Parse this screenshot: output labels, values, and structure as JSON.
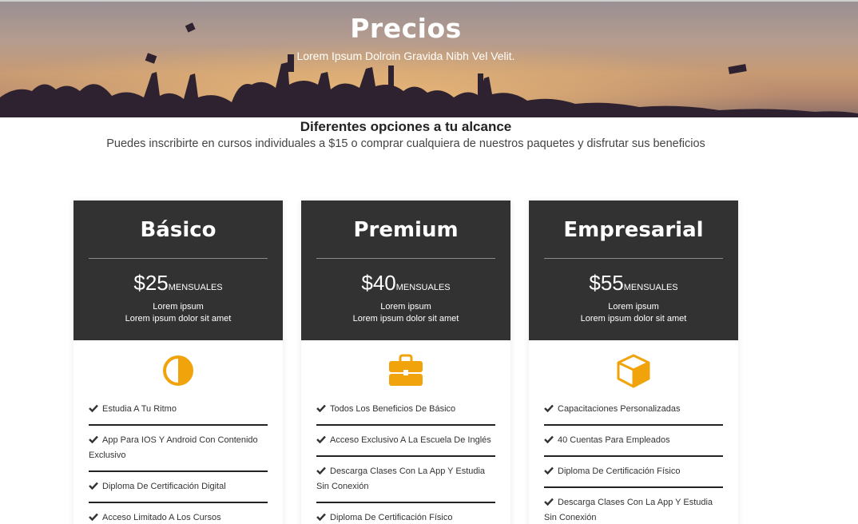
{
  "hero": {
    "title": "Precios",
    "subtitle": "Lorem Ipsum Dolroin Gravida Nibh Vel Velit."
  },
  "intro": {
    "title": "Diferentes opciones a tu alcance",
    "text": "Puedes inscribirte en cursos individuales a $15 o comprar cualquiera de nuestros paquetes y disfrutar sus beneficios"
  },
  "colors": {
    "accent": "#f0a30a",
    "card_header": "#333232"
  },
  "plans": [
    {
      "name": "Básico",
      "amount": "$25",
      "period": "MENSUALES",
      "line1": "Lorem ipsum",
      "line2": "Lorem ipsum dolor sit amet",
      "icon": "half-circle-icon",
      "features": [
        "Estudia A Tu Ritmo",
        "App Para IOS Y Android Con Contenido Exclusivo",
        "Diploma De Certificación Digital",
        "Acceso Limitado A Los Cursos"
      ]
    },
    {
      "name": "Premium",
      "amount": "$40",
      "period": "MENSUALES",
      "line1": "Lorem ipsum",
      "line2": "Lorem ipsum dolor sit amet",
      "icon": "briefcase-icon",
      "features": [
        "Todos Los Beneficios De Básico",
        "Acceso Exclusivo A La Escuela De Inglés",
        "Descarga Clases Con La App Y Estudia Sin Conexión",
        "Diploma De Certificación Físico"
      ]
    },
    {
      "name": "Empresarial",
      "amount": "$55",
      "period": "MENSUALES",
      "line1": "Lorem ipsum",
      "line2": "Lorem ipsum dolor sit amet",
      "icon": "cube-icon",
      "features": [
        "Capacitaciones Personalizadas",
        "40 Cuentas Para Empleados",
        "Diploma De Certificación Físico",
        "Descarga Clases Con La App Y Estudia Sin Conexión"
      ]
    }
  ]
}
